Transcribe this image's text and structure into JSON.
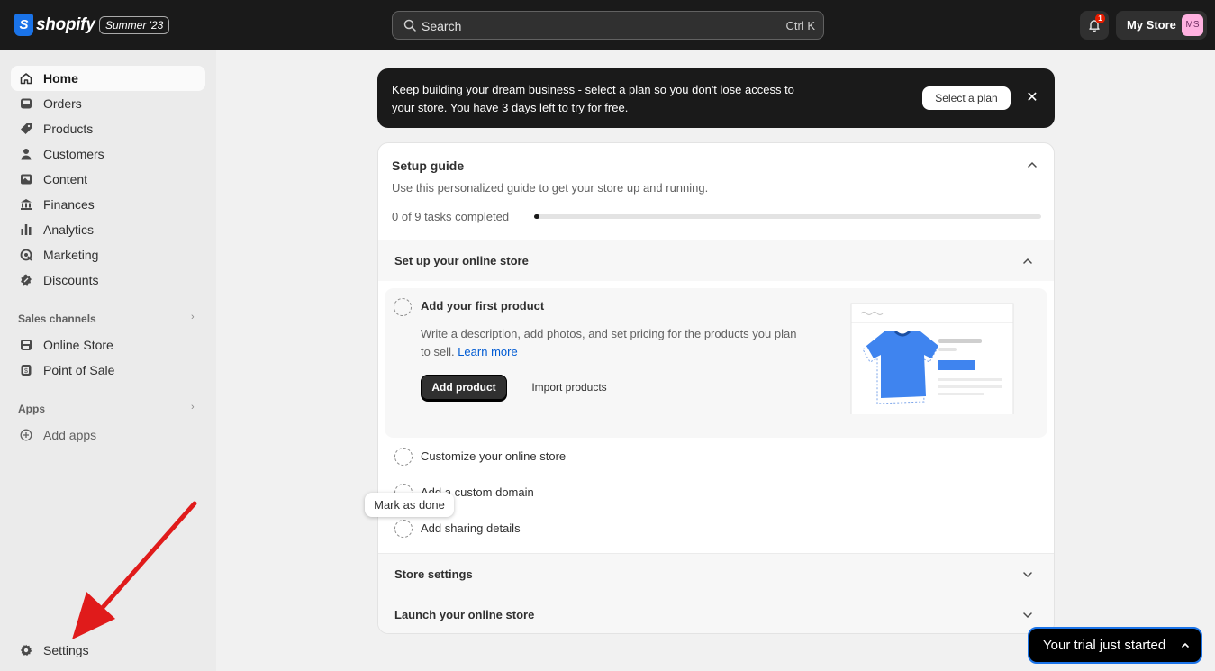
{
  "topbar": {
    "brand": "shopify",
    "edition": "Summer '23",
    "search_placeholder": "Search",
    "search_shortcut": "Ctrl K",
    "notification_count": "1",
    "store_name": "My Store",
    "avatar_initials": "MS"
  },
  "sidebar": {
    "items": [
      {
        "label": "Home",
        "icon": "home-icon"
      },
      {
        "label": "Orders",
        "icon": "inbox-icon"
      },
      {
        "label": "Products",
        "icon": "tag-icon"
      },
      {
        "label": "Customers",
        "icon": "person-icon"
      },
      {
        "label": "Content",
        "icon": "image-icon"
      },
      {
        "label": "Finances",
        "icon": "bank-icon"
      },
      {
        "label": "Analytics",
        "icon": "bar-chart-icon"
      },
      {
        "label": "Marketing",
        "icon": "target-icon"
      },
      {
        "label": "Discounts",
        "icon": "discount-icon"
      }
    ],
    "sales_channels_label": "Sales channels",
    "sales_channels": [
      {
        "label": "Online Store",
        "icon": "storefront-icon"
      },
      {
        "label": "Point of Sale",
        "icon": "pos-icon"
      }
    ],
    "apps_label": "Apps",
    "apps": [
      {
        "label": "Add apps",
        "icon": "plus-circle-icon"
      }
    ],
    "settings_label": "Settings"
  },
  "banner": {
    "text": "Keep building your dream business - select a plan so you don't lose access to your store. You have 3 days left to try for free.",
    "button": "Select a plan",
    "close": "✕"
  },
  "setup_guide": {
    "title": "Setup guide",
    "subtitle": "Use this personalized guide to get your store up and running.",
    "progress_text": "0 of 9 tasks completed",
    "progress_fraction": 0.01,
    "sections": [
      {
        "label": "Set up your online store"
      },
      {
        "label": "Store settings"
      },
      {
        "label": "Launch your online store"
      }
    ],
    "active_task": {
      "title": "Add your first product",
      "description": "Write a description, add photos, and set pricing for the products you plan to sell.",
      "learn_more": "Learn more",
      "primary_button": "Add product",
      "secondary_button": "Import products"
    },
    "tasks": [
      {
        "title": "Customize your online store"
      },
      {
        "title": "Add a custom domain"
      },
      {
        "title": "Add sharing details"
      }
    ],
    "tooltip": "Mark as done"
  },
  "trial": {
    "label": "Your trial just started"
  },
  "colors": {
    "topbar": "#1a1a1a",
    "sidebar": "#ebebeb",
    "accent_link": "#005bd3",
    "annotation_arrow": "#e01b1b"
  }
}
